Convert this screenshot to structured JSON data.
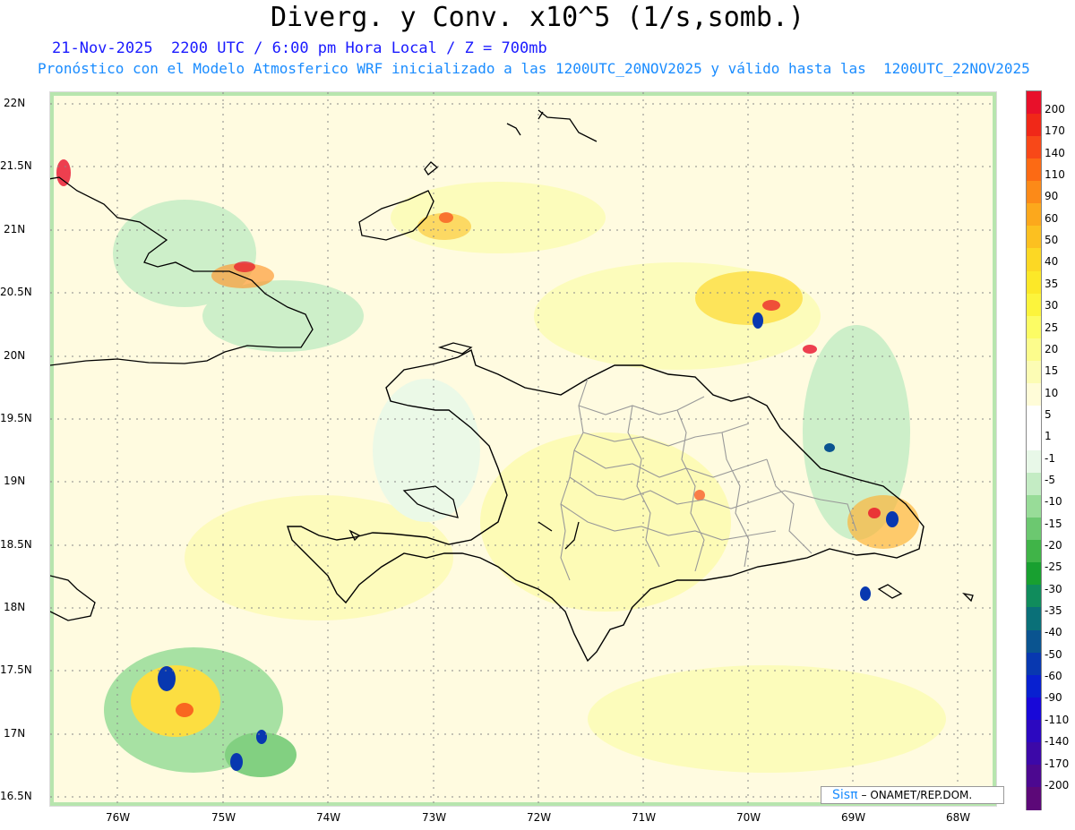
{
  "title": "Diverg. y Conv. x10^5 (1/s,somb.)",
  "subtitle_line1": "21-Nov-2025  2200 UTC / 6:00 pm Hora Local / Z = 700mb",
  "subtitle_line2": "Pronóstico con el Modelo Atmosferico WRF inicializado a las 1200UTC_20NOV2025 y válido hasta las  1200UTC_22NOV2025",
  "lat_labels": [
    "22N",
    "21.5N",
    "21N",
    "20.5N",
    "20N",
    "19.5N",
    "19N",
    "18.5N",
    "18N",
    "17.5N",
    "17N",
    "16.5N"
  ],
  "lon_labels": [
    "76W",
    "75W",
    "74W",
    "73W",
    "72W",
    "71W",
    "70W",
    "69W",
    "68W"
  ],
  "colorbar_labels": [
    "200",
    "170",
    "140",
    "110",
    "90",
    "60",
    "50",
    "40",
    "35",
    "30",
    "25",
    "20",
    "15",
    "10",
    "5",
    "1",
    "-1",
    "-5",
    "-10",
    "-15",
    "-20",
    "-25",
    "-30",
    "-35",
    "-40",
    "-50",
    "-60",
    "-90",
    "-110",
    "-140",
    "-170",
    "-200"
  ],
  "colorbar_colors": [
    "#e8102a",
    "#f02818",
    "#f84818",
    "#fc6a14",
    "#fc8a18",
    "#fca81c",
    "#fcc020",
    "#fcd824",
    "#fce828",
    "#fcf43c",
    "#fcfc64",
    "#fcfc8c",
    "#fcfcb4",
    "#fffcd8",
    "#ffffff",
    "#ffffff",
    "#e8f8e8",
    "#c4ecc4",
    "#98dc98",
    "#6cc870",
    "#40b448",
    "#18a030",
    "#108c5c",
    "#0a7078",
    "#0a5490",
    "#0838b0",
    "#0820d0",
    "#1808d8",
    "#2c08c0",
    "#3c08a8",
    "#4c0890",
    "#5c0878"
  ],
  "credit": {
    "logo": "Sisπ",
    "text": "– ONAMET/REP.DOM."
  }
}
